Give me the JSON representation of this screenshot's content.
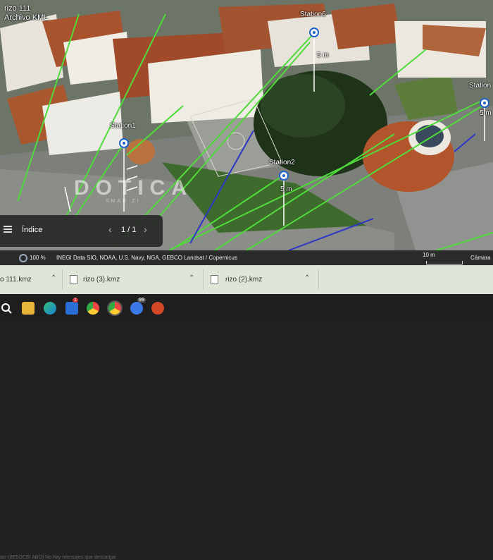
{
  "kml": {
    "title": "rizo 111",
    "subtitle": "Archivo KML"
  },
  "stations": [
    {
      "name": "Station1",
      "distance": ""
    },
    {
      "name": "Station2",
      "distance": "5 m"
    },
    {
      "name": "Station6",
      "distance": ""
    },
    {
      "name": "Station",
      "distance": "5 m"
    }
  ],
  "extra_distance": "5 m",
  "watermark": {
    "main": "DOTICA",
    "sub": "SMAR ZI"
  },
  "index_panel": {
    "title": "Índice",
    "page": "1 / 1"
  },
  "status_bar": {
    "zoom": "100 %",
    "attribution": "INEGI  Data SIO, NOAA, U.S. Navy, NGA, GEBCO  Landsat / Copernicus",
    "scale": "10 m",
    "camera": "Cámara"
  },
  "downloads": [
    {
      "name": "o 111.kmz"
    },
    {
      "name": "rizo (3).kmz"
    },
    {
      "name": "rizo (2).kmz"
    }
  ],
  "behind_text": "acr (8E5OCEI ABO)  No hay mensajes que descargar",
  "taskbar": {
    "icons": [
      "search-icon",
      "file-explorer-icon",
      "edge-icon",
      "mail-icon",
      "chrome-icon",
      "chrome-profile-icon",
      "clock-icon",
      "powerpoint-icon"
    ],
    "mail_badge": "1",
    "clock_badge": "99"
  },
  "colors": {
    "link_green": "#4fdc3a",
    "link_blue": "#2e36c6",
    "pin": "#1f62c7"
  }
}
